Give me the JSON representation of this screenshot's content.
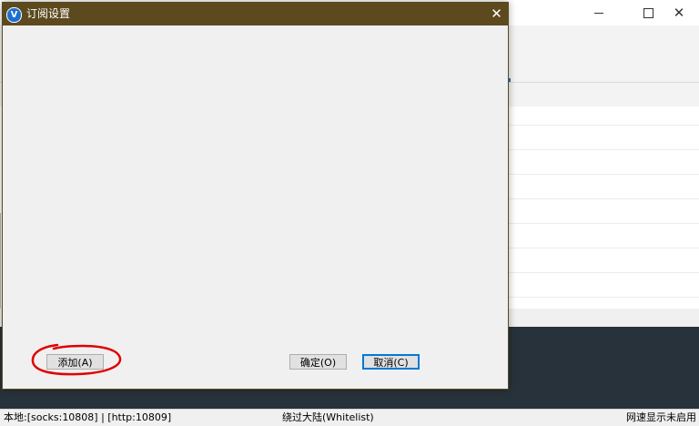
{
  "dialog": {
    "title": "订阅设置",
    "close_glyph": "✕",
    "icon_glyph": "V",
    "buttons": {
      "add_label": "添加(A)",
      "ok_label": "确定(O)",
      "cancel_label": "取消(C)"
    }
  },
  "window": {
    "close_glyph": "✕"
  },
  "statusbar": {
    "local_ports": "本地:[socks:10808] | [http:10809]",
    "routing": "绕过大陆(Whitelist)",
    "speed": "网速显示未启用"
  },
  "colors": {
    "dialog_titlebar": "#5c4a1e",
    "console_bg": "#28323a",
    "annotation": "#e00000",
    "focus_border": "#0078d7"
  }
}
